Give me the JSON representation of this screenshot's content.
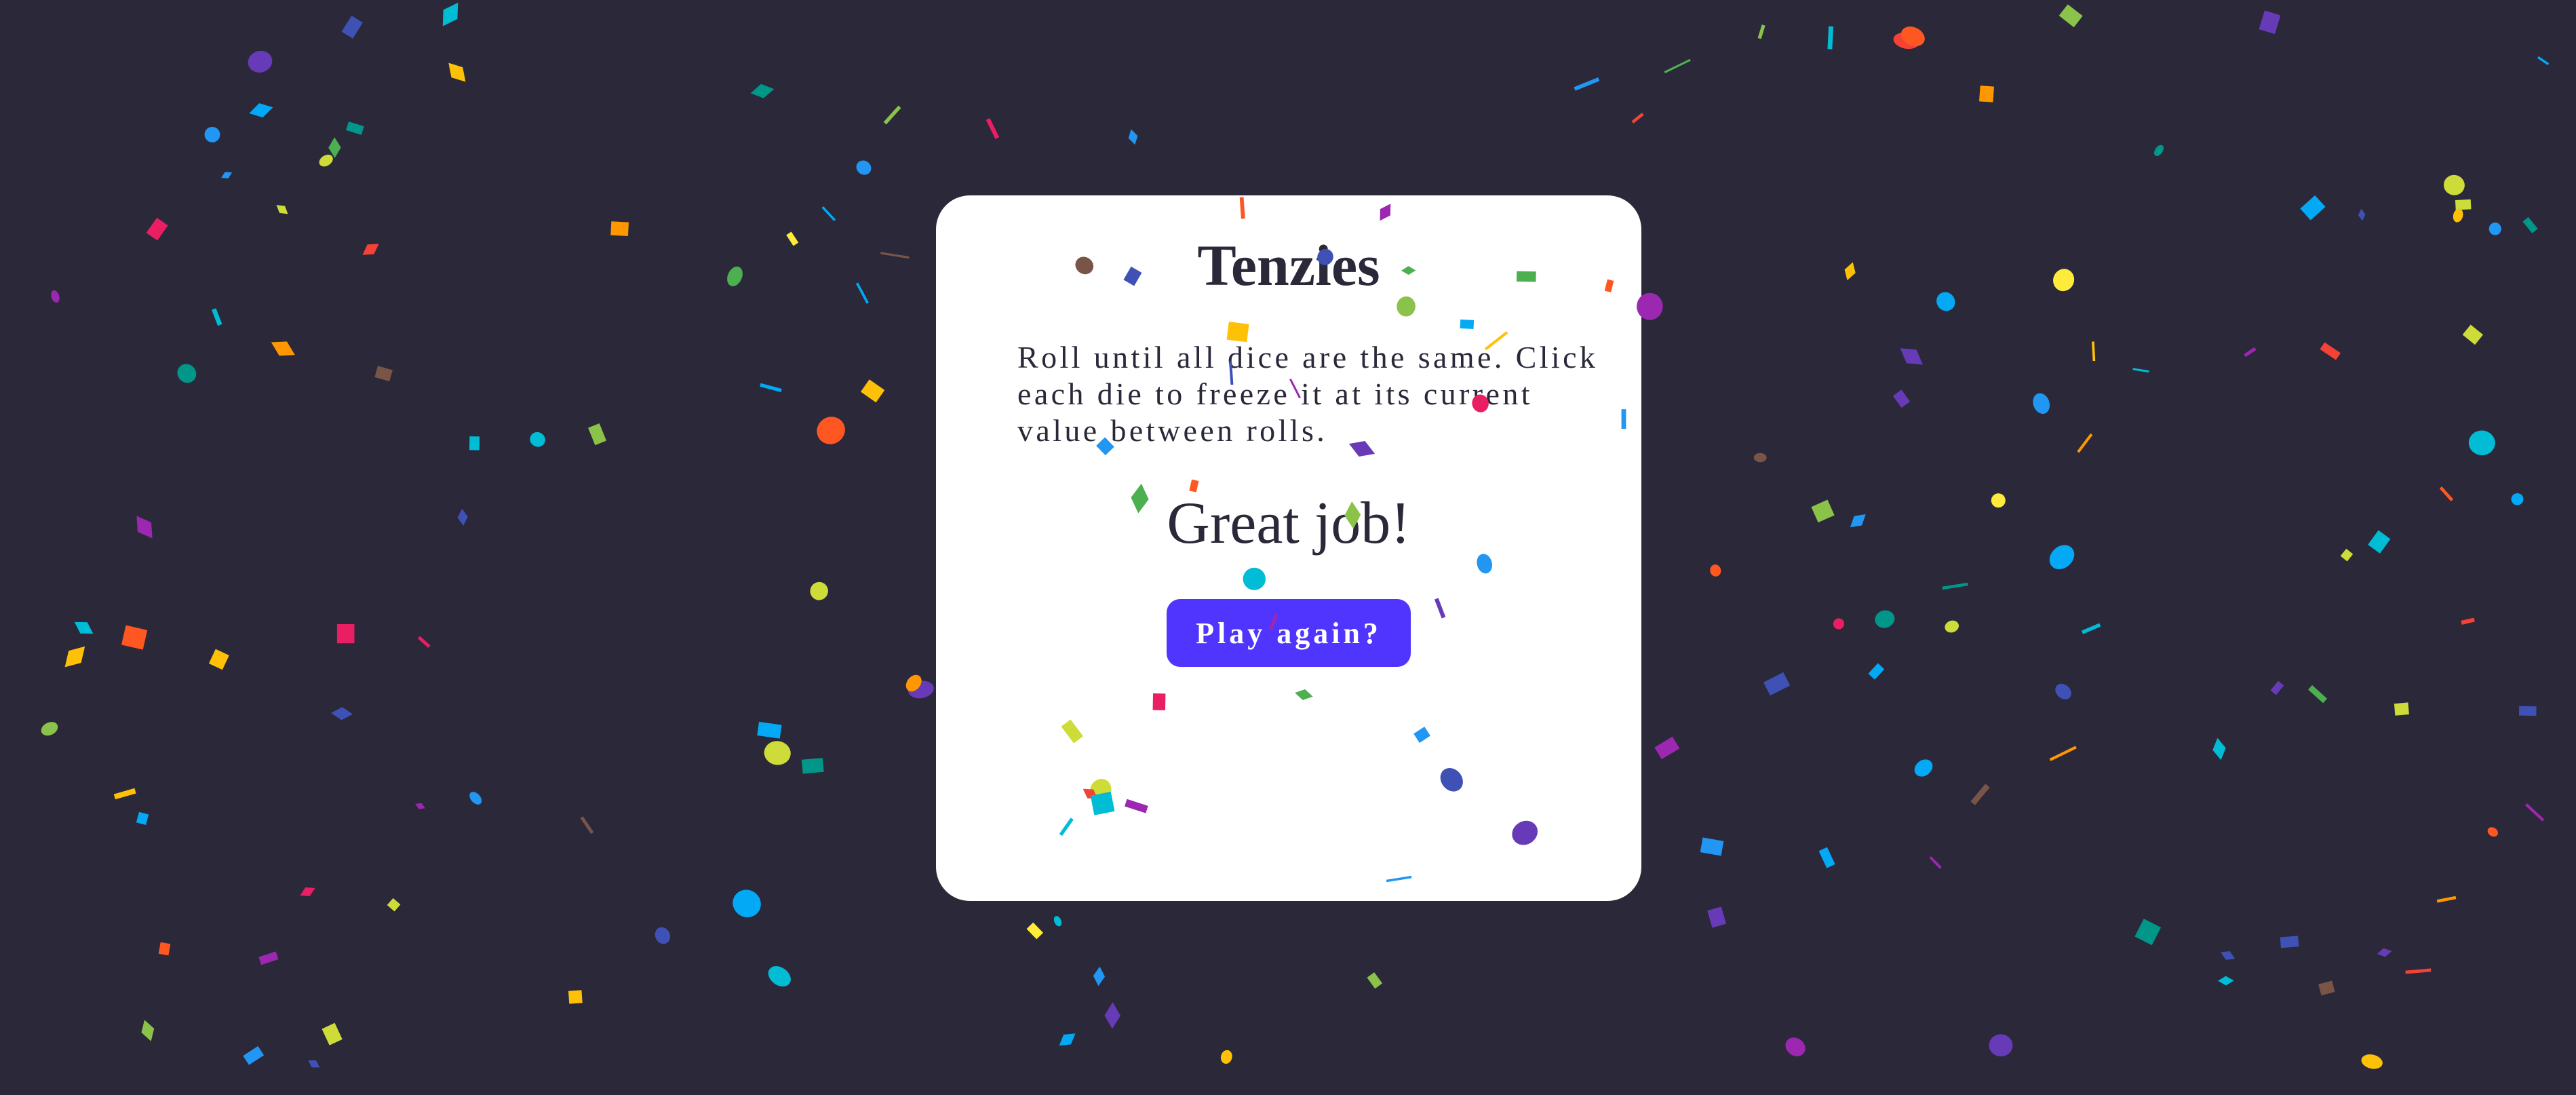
{
  "game": {
    "title": "Tenzies",
    "instructions": "Roll until all dice are the same. Click each die to freeze it at its current value between rolls.",
    "status": "Great job!",
    "play_again_label": "Play again?"
  },
  "colors": {
    "background": "#2a2839",
    "card": "#ffffff",
    "text": "#2a2839",
    "button": "#5035ff",
    "button_text": "#ffffff",
    "confetti_palette": [
      "#f44336",
      "#e91e63",
      "#9c27b0",
      "#673ab7",
      "#3f51b5",
      "#2196f3",
      "#03a9f4",
      "#00bcd4",
      "#009688",
      "#4caf50",
      "#8bc34a",
      "#cddc39",
      "#ffeb3b",
      "#ffc107",
      "#ff9800",
      "#ff5722",
      "#795548"
    ]
  }
}
